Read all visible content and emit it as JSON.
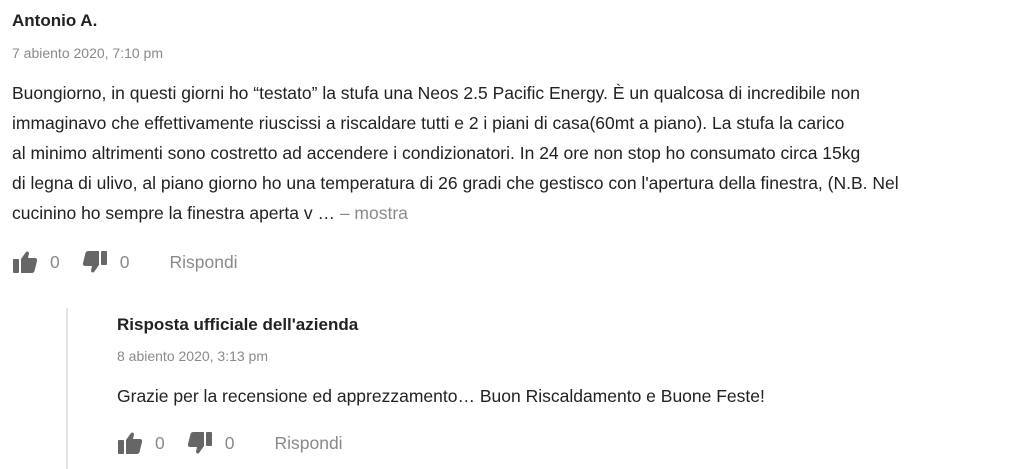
{
  "review": {
    "author": "Antonio A.",
    "date": "7 abiento 2020, 7:10 pm",
    "body_lines": [
      "Buongiorno, in questi giorni ho “testato” la stufa una Neos 2.5 Pacific Energy. È un qualcosa di incredibile non",
      "immaginavo che effettivamente riuscissi a riscaldare tutti e 2 i piani di casa(60mt a piano). La stufa la carico",
      "al minimo altrimenti sono costretto ad accendere i condizionatori. In 24 ore non stop ho consumato circa 15kg",
      "di legna di ulivo, al piano giorno ho una temperatura di 26 gradi che gestisco con l'apertura della finestra, (N.B. Nel",
      "cucinino ho sempre la finestra aperta v …"
    ],
    "more_label": "– mostra",
    "likes": "0",
    "dislikes": "0",
    "reply_label": "Rispondi"
  },
  "official_reply": {
    "author": "Risposta ufficiale dell'azienda",
    "date": "8 abiento 2020, 3:13 pm",
    "text": "Grazie per la recensione ed apprezzamento… Buon Riscaldamento e Buone Feste!",
    "likes": "0",
    "dislikes": "0",
    "reply_label": "Rispondi"
  },
  "colors": {
    "text": "#222222",
    "muted": "#8a8a8a",
    "icon": "#666666",
    "thread_line": "#e4e4e4"
  },
  "icons": {
    "like": "thumbs-up-icon",
    "dislike": "thumbs-down-icon"
  }
}
